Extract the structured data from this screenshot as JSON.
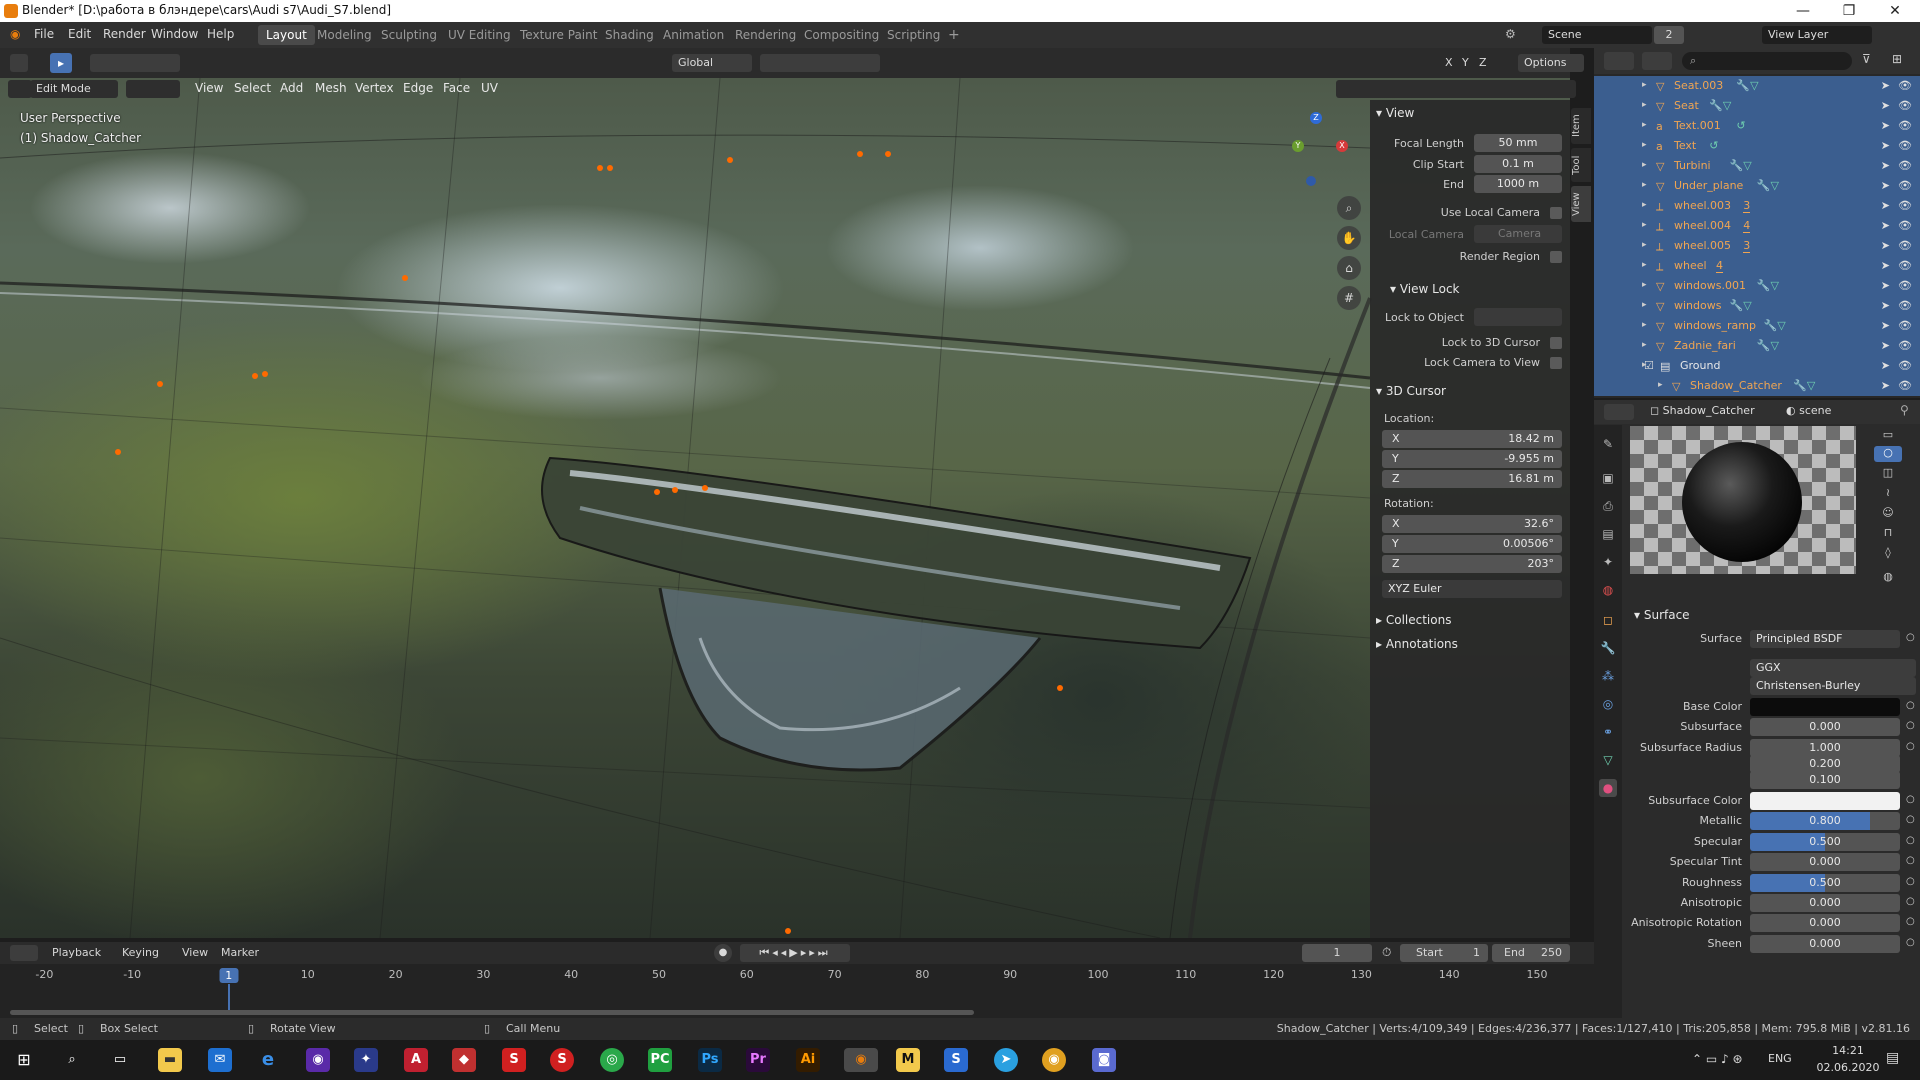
{
  "window": {
    "title": "Blender* [D:\\работа в блэндере\\cars\\Audi s7\\Audi_S7.blend]",
    "minimize": "—",
    "maximize": "❐",
    "close": "✕"
  },
  "topbar": {
    "menus": [
      "File",
      "Edit",
      "Render",
      "Window",
      "Help"
    ],
    "workspaces": [
      "Layout",
      "Modeling",
      "Sculpting",
      "UV Editing",
      "Texture Paint",
      "Shading",
      "Animation",
      "Rendering",
      "Compositing",
      "Scripting"
    ],
    "active_workspace": "Layout",
    "add_workspace": "+",
    "scene_label": "Scene",
    "scene_count": "2",
    "view_layer_label": "View Layer"
  },
  "tool_header": {
    "orientation": "Global",
    "axes": [
      "X",
      "Y",
      "Z"
    ],
    "options": "Options"
  },
  "viewport_header": {
    "mode": "Edit Mode",
    "menus": [
      "View",
      "Select",
      "Add",
      "Mesh",
      "Vertex",
      "Edge",
      "Face",
      "UV"
    ]
  },
  "viewport_overlay": {
    "perspective": "User Perspective",
    "object": "(1) Shadow_Catcher",
    "gizmo": {
      "x": "X",
      "y": "Y",
      "z": "Z"
    }
  },
  "npanel": {
    "tabs": [
      "Item",
      "Tool",
      "View"
    ],
    "view": {
      "header": "View",
      "focal_length_label": "Focal Length",
      "focal_length": "50 mm",
      "clip_start_label": "Clip Start",
      "clip_start": "0.1 m",
      "end_label": "End",
      "end": "1000 m",
      "use_local_camera": "Use Local Camera",
      "local_camera_label": "Local Camera",
      "local_camera": "Camera",
      "render_region": "Render Region"
    },
    "view_lock": {
      "header": "View Lock",
      "lock_to_object": "Lock to Object",
      "lock_to_cursor": "Lock to 3D Cursor",
      "lock_camera": "Lock Camera to View"
    },
    "cursor": {
      "header": "3D Cursor",
      "location_label": "Location:",
      "loc_x_label": "X",
      "loc_x": "18.42 m",
      "loc_y_label": "Y",
      "loc_y": "-9.955 m",
      "loc_z_label": "Z",
      "loc_z": "16.81 m",
      "rotation_label": "Rotation:",
      "rot_x_label": "X",
      "rot_x": "32.6°",
      "rot_y_label": "Y",
      "rot_y": "0.00506°",
      "rot_z_label": "Z",
      "rot_z": "203°",
      "rotation_mode": "XYZ Euler"
    },
    "collections": "Collections",
    "annotations": "Annotations"
  },
  "outliner": {
    "items": [
      {
        "name": "Seat.003",
        "icon": "mesh-icon"
      },
      {
        "name": "Seat",
        "icon": "mesh-icon"
      },
      {
        "name": "Text.001",
        "icon": "text-icon"
      },
      {
        "name": "Text",
        "icon": "text-icon"
      },
      {
        "name": "Turbini",
        "icon": "mesh-icon"
      },
      {
        "name": "Under_plane",
        "icon": "mesh-icon"
      },
      {
        "name": "wheel.003",
        "icon": "empty-icon"
      },
      {
        "name": "wheel.004",
        "icon": "empty-icon"
      },
      {
        "name": "wheel.005",
        "icon": "empty-icon"
      },
      {
        "name": "wheel",
        "icon": "empty-icon"
      },
      {
        "name": "windows.001",
        "icon": "mesh-icon"
      },
      {
        "name": "windows",
        "icon": "mesh-icon"
      },
      {
        "name": "windows_ramp",
        "icon": "mesh-icon"
      },
      {
        "name": "Zadnie_fari",
        "icon": "mesh-icon"
      },
      {
        "name": "Ground",
        "icon": "collection-icon"
      },
      {
        "name": "Shadow_Catcher",
        "icon": "mesh-icon"
      }
    ],
    "wheel_counts": [
      "3",
      "4",
      "3",
      "4"
    ]
  },
  "properties": {
    "object": "Shadow_Catcher",
    "world": "scene",
    "surface_header": "Surface",
    "rows": [
      {
        "label": "Surface",
        "value": "Principled BSDF"
      },
      {
        "label": "",
        "value": "GGX"
      },
      {
        "label": "",
        "value": "Christensen-Burley"
      },
      {
        "label": "Base Color",
        "value": ""
      },
      {
        "label": "Subsurface",
        "value": "0.000"
      },
      {
        "label": "Subsurface Radius",
        "value": "1.000"
      },
      {
        "label": "",
        "value": "0.200"
      },
      {
        "label": "",
        "value": "0.100"
      },
      {
        "label": "Subsurface Color",
        "value": ""
      },
      {
        "label": "Metallic",
        "value": "0.800"
      },
      {
        "label": "Specular",
        "value": "0.500"
      },
      {
        "label": "Specular Tint",
        "value": "0.000"
      },
      {
        "label": "Roughness",
        "value": "0.500"
      },
      {
        "label": "Anisotropic",
        "value": "0.000"
      },
      {
        "label": "Anisotropic Rotation",
        "value": "0.000"
      },
      {
        "label": "Sheen",
        "value": "0.000"
      }
    ],
    "fills": {
      "metallic": 0.8,
      "specular": 0.5,
      "roughness": 0.5
    }
  },
  "timeline": {
    "menus": [
      "Playback",
      "Keying",
      "View",
      "Marker"
    ],
    "current_frame": "1",
    "start_label": "Start",
    "start": "1",
    "end_label": "End",
    "end": "250",
    "ticks": [
      "-20",
      "-10",
      "1",
      "10",
      "20",
      "30",
      "40",
      "50",
      "60",
      "70",
      "80",
      "90",
      "100",
      "110",
      "120",
      "130",
      "140",
      "150"
    ]
  },
  "statusbar": {
    "select": "Select",
    "box_select": "Box Select",
    "rotate_view": "Rotate View",
    "call_menu": "Call Menu",
    "stats": "Shadow_Catcher | Verts:4/109,349 | Edges:4/236,377 | Faces:1/127,410 | Tris:205,858 | Mem: 795.8 MiB | v2.81.16"
  },
  "taskbar": {
    "lang": "ENG",
    "time": "14:21",
    "date": "02.06.2020"
  },
  "colors": {
    "accent": "#4772b3",
    "object_orange": "#f0a552",
    "selected_row": "#3b5e8f"
  }
}
